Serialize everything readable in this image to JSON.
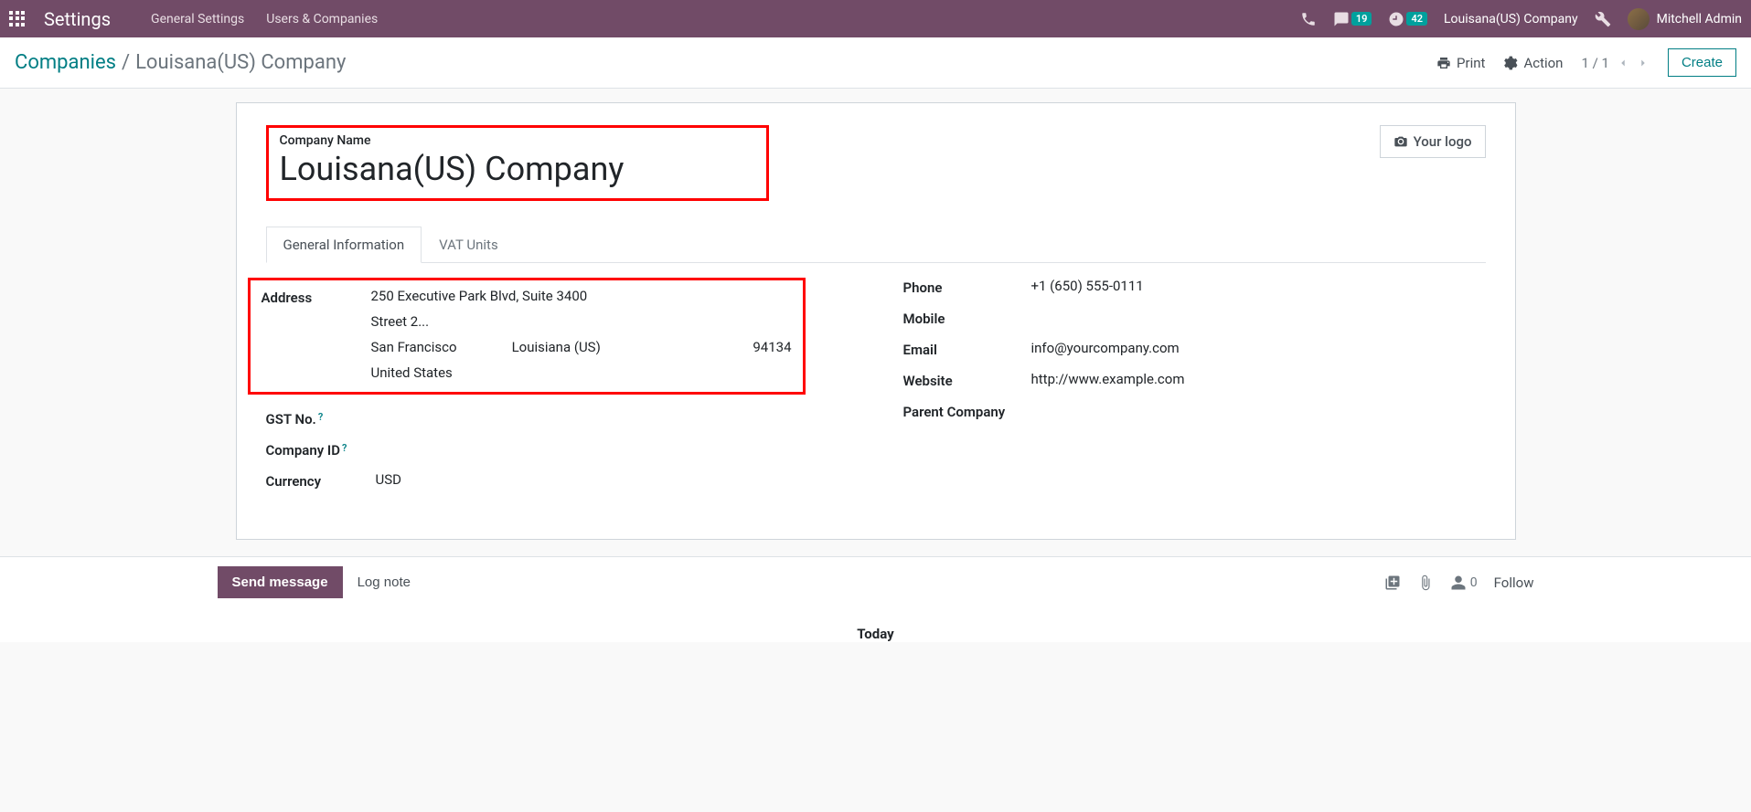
{
  "topbar": {
    "title": "Settings",
    "menu": [
      "General Settings",
      "Users & Companies"
    ],
    "messages_badge": "19",
    "activities_badge": "42",
    "company_name": "Louisana(US) Company",
    "user_name": "Mitchell Admin"
  },
  "control_panel": {
    "breadcrumb_root": "Companies",
    "breadcrumb_current": "Louisana(US) Company",
    "print_label": "Print",
    "action_label": "Action",
    "pager": "1 / 1",
    "create_label": "Create"
  },
  "form": {
    "company_name_label": "Company Name",
    "company_name_value": "Louisana(US) Company",
    "logo_label": "Your logo",
    "tabs": [
      "General Information",
      "VAT Units"
    ],
    "left": {
      "address_label": "Address",
      "street": "250 Executive Park Blvd, Suite 3400",
      "street2_placeholder": "Street 2...",
      "city": "San Francisco",
      "state": "Louisiana (US)",
      "zip": "94134",
      "country": "United States",
      "gst_label": "GST No.",
      "company_id_label": "Company ID",
      "currency_label": "Currency",
      "currency_value": "USD"
    },
    "right": {
      "phone_label": "Phone",
      "phone_value": "+1 (650) 555-0111",
      "mobile_label": "Mobile",
      "email_label": "Email",
      "email_value": "info@yourcompany.com",
      "website_label": "Website",
      "website_value": "http://www.example.com",
      "parent_label": "Parent Company"
    }
  },
  "chatter": {
    "send_label": "Send message",
    "lognote_label": "Log note",
    "followers_count": "0",
    "follow_label": "Follow",
    "today_label": "Today"
  }
}
